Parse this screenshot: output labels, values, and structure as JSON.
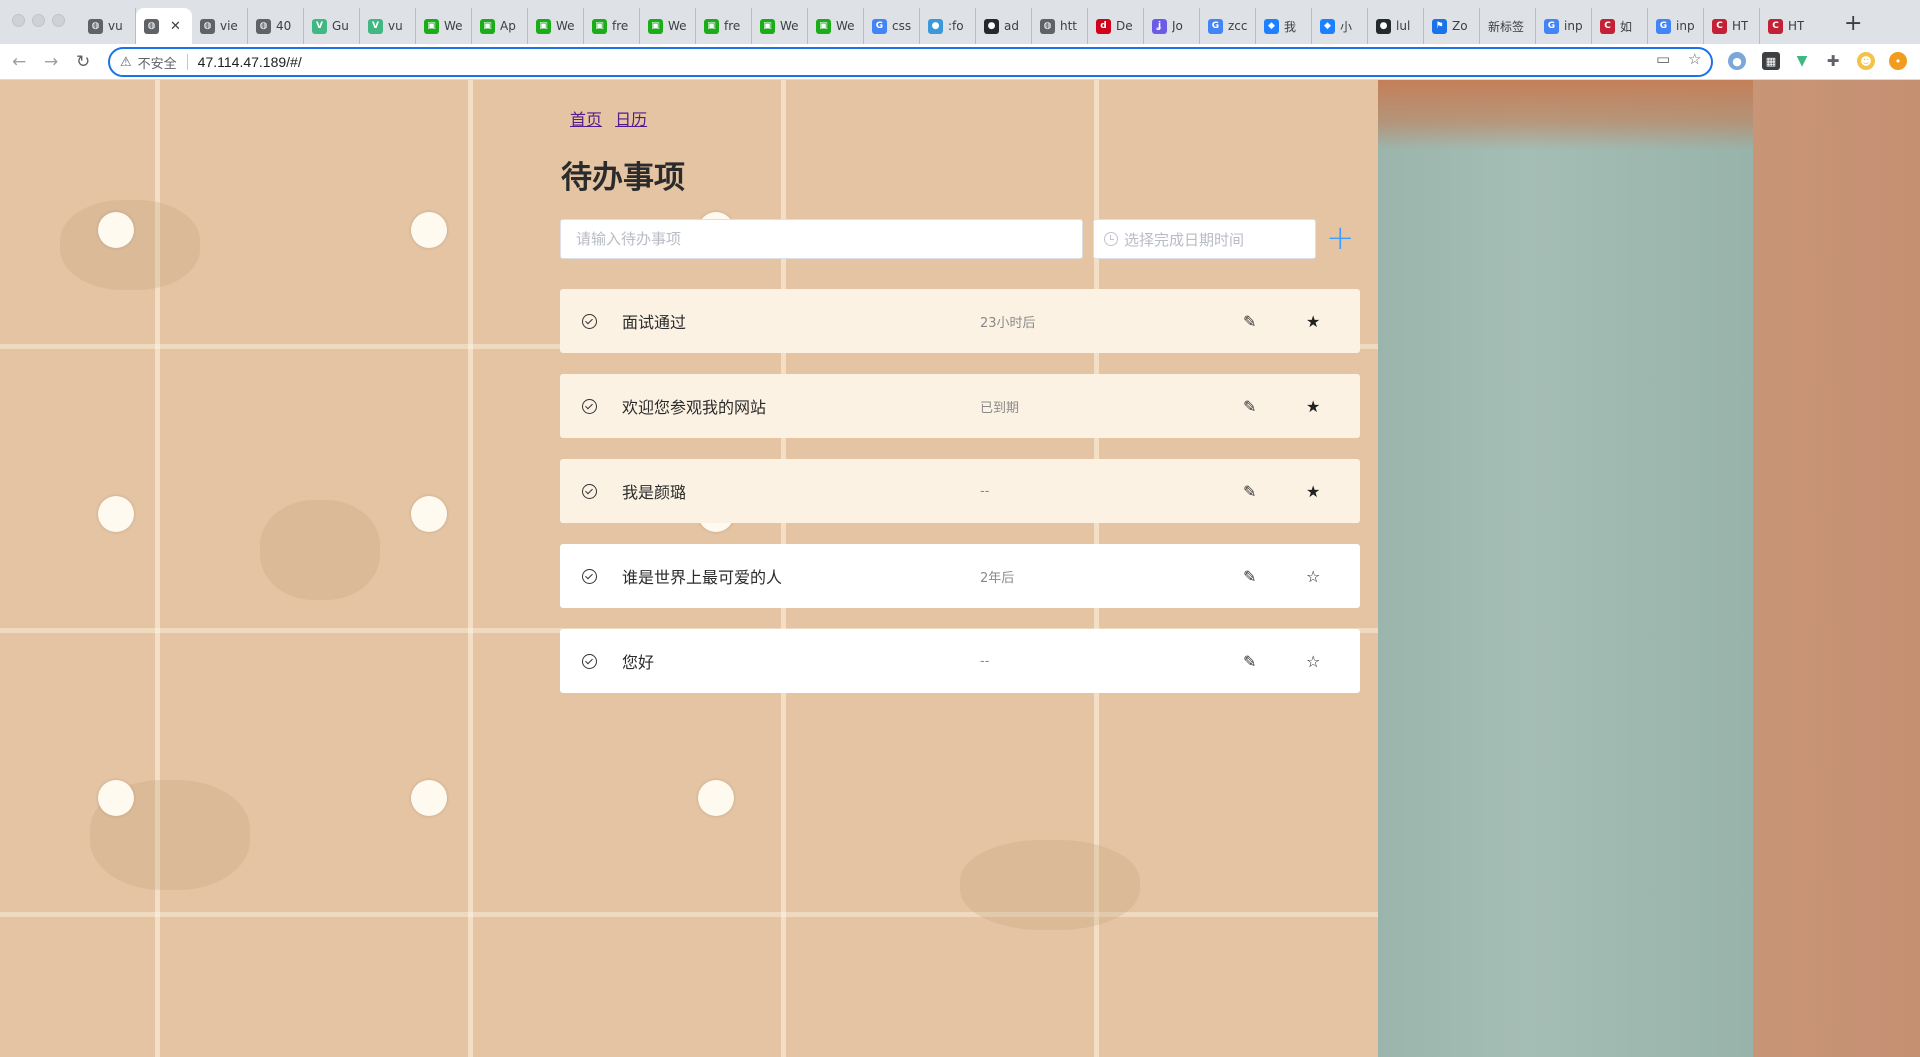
{
  "browser": {
    "tabs": [
      {
        "label": "vu",
        "favicon": "globe-icon",
        "color": "#5f6368"
      },
      {
        "label": "",
        "favicon": "globe-icon",
        "color": "#5f6368",
        "active": true
      },
      {
        "label": "vie",
        "favicon": "globe-icon",
        "color": "#5f6368"
      },
      {
        "label": "40",
        "favicon": "globe-icon",
        "color": "#5f6368"
      },
      {
        "label": "Gu",
        "favicon": "vue-icon",
        "color": "#41b883"
      },
      {
        "label": "vu",
        "favicon": "vue-icon",
        "color": "#41b883"
      },
      {
        "label": "We",
        "favicon": "wechat-dev-icon",
        "color": "#1aad19"
      },
      {
        "label": "Ap",
        "favicon": "wechat-dev-icon",
        "color": "#1aad19"
      },
      {
        "label": "We",
        "favicon": "wechat-dev-icon",
        "color": "#1aad19"
      },
      {
        "label": "fre",
        "favicon": "wechat-dev-icon",
        "color": "#1aad19"
      },
      {
        "label": "We",
        "favicon": "wechat-dev-icon",
        "color": "#1aad19"
      },
      {
        "label": "fre",
        "favicon": "wechat-dev-icon",
        "color": "#1aad19"
      },
      {
        "label": "We",
        "favicon": "wechat-dev-icon",
        "color": "#1aad19"
      },
      {
        "label": "We",
        "favicon": "wechat-dev-icon",
        "color": "#1aad19"
      },
      {
        "label": "css",
        "favicon": "google-icon",
        "color": "#4285f4"
      },
      {
        "label": ":fo",
        "favicon": "bird-icon",
        "color": "#3a99d8"
      },
      {
        "label": "ad",
        "favicon": "github-icon",
        "color": "#24292e"
      },
      {
        "label": "htt",
        "favicon": "globe-icon",
        "color": "#5f6368"
      },
      {
        "label": "De",
        "favicon": "dev-icon",
        "color": "#d0021b"
      },
      {
        "label": "Jo",
        "favicon": "joi-icon",
        "color": "#6b5ce7"
      },
      {
        "label": "zcc",
        "favicon": "google-icon",
        "color": "#4285f4"
      },
      {
        "label": "我",
        "favicon": "juejin-icon",
        "color": "#1e80ff"
      },
      {
        "label": "小",
        "favicon": "juejin-icon",
        "color": "#1e80ff"
      },
      {
        "label": "lul",
        "favicon": "github-icon",
        "color": "#24292e"
      },
      {
        "label": "Zo",
        "favicon": "flag-icon",
        "color": "#1a73e8"
      },
      {
        "label": "新标签",
        "favicon": "",
        "color": "#5f6368"
      },
      {
        "label": "inp",
        "favicon": "google-icon",
        "color": "#4285f4"
      },
      {
        "label": "如",
        "favicon": "csdn-icon",
        "color": "#c32136"
      },
      {
        "label": "inp",
        "favicon": "google-icon",
        "color": "#4285f4"
      },
      {
        "label": "HT",
        "favicon": "csdn-icon",
        "color": "#c32136"
      },
      {
        "label": "HT",
        "favicon": "csdn-icon",
        "color": "#c32136"
      }
    ],
    "security_label": "不安全",
    "url": "47.114.47.189/#/"
  },
  "page": {
    "nav": {
      "home": "首页",
      "calendar": "日历"
    },
    "title": "待办事项",
    "input_placeholder": "请输入待办事项",
    "date_placeholder": "选择完成日期时间",
    "add_symbol": "+",
    "todos": [
      {
        "text": "面试通过",
        "due": "23小时后",
        "starred": true,
        "edit_glyph": "✎",
        "star_glyph": "★"
      },
      {
        "text": "欢迎您参观我的网站",
        "due": "已到期",
        "starred": true,
        "edit_glyph": "✎",
        "star_glyph": "★"
      },
      {
        "text": "我是颜璐",
        "due": "--",
        "starred": true,
        "edit_glyph": "✎",
        "star_glyph": "★"
      },
      {
        "text": "谁是世界上最可爱的人",
        "due": "2年后",
        "starred": false,
        "edit_glyph": "✎",
        "star_glyph": "☆"
      },
      {
        "text": "您好",
        "due": "--",
        "starred": false,
        "edit_glyph": "✎",
        "star_glyph": "☆"
      }
    ]
  },
  "colors": {
    "accent": "#409eff",
    "starred_row_bg": "#fcf2e4",
    "plain_row_bg": "#ffffff",
    "link": "#551a8b"
  }
}
